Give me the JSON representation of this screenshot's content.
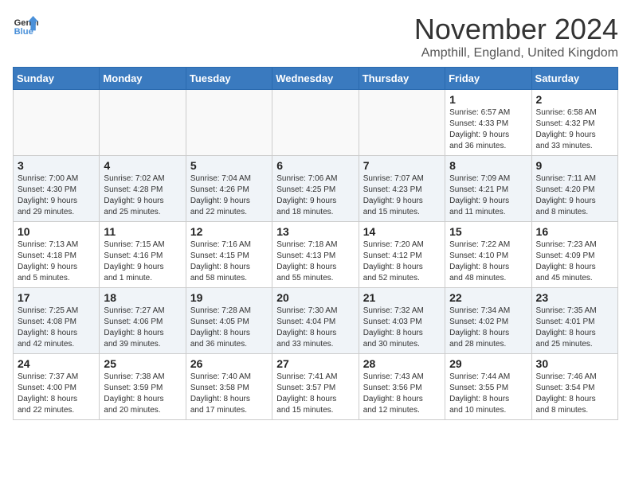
{
  "header": {
    "logo_general": "General",
    "logo_blue": "Blue",
    "month_title": "November 2024",
    "location": "Ampthill, England, United Kingdom"
  },
  "weekdays": [
    "Sunday",
    "Monday",
    "Tuesday",
    "Wednesday",
    "Thursday",
    "Friday",
    "Saturday"
  ],
  "weeks": [
    [
      {
        "num": "",
        "info": ""
      },
      {
        "num": "",
        "info": ""
      },
      {
        "num": "",
        "info": ""
      },
      {
        "num": "",
        "info": ""
      },
      {
        "num": "",
        "info": ""
      },
      {
        "num": "1",
        "info": "Sunrise: 6:57 AM\nSunset: 4:33 PM\nDaylight: 9 hours\nand 36 minutes."
      },
      {
        "num": "2",
        "info": "Sunrise: 6:58 AM\nSunset: 4:32 PM\nDaylight: 9 hours\nand 33 minutes."
      }
    ],
    [
      {
        "num": "3",
        "info": "Sunrise: 7:00 AM\nSunset: 4:30 PM\nDaylight: 9 hours\nand 29 minutes."
      },
      {
        "num": "4",
        "info": "Sunrise: 7:02 AM\nSunset: 4:28 PM\nDaylight: 9 hours\nand 25 minutes."
      },
      {
        "num": "5",
        "info": "Sunrise: 7:04 AM\nSunset: 4:26 PM\nDaylight: 9 hours\nand 22 minutes."
      },
      {
        "num": "6",
        "info": "Sunrise: 7:06 AM\nSunset: 4:25 PM\nDaylight: 9 hours\nand 18 minutes."
      },
      {
        "num": "7",
        "info": "Sunrise: 7:07 AM\nSunset: 4:23 PM\nDaylight: 9 hours\nand 15 minutes."
      },
      {
        "num": "8",
        "info": "Sunrise: 7:09 AM\nSunset: 4:21 PM\nDaylight: 9 hours\nand 11 minutes."
      },
      {
        "num": "9",
        "info": "Sunrise: 7:11 AM\nSunset: 4:20 PM\nDaylight: 9 hours\nand 8 minutes."
      }
    ],
    [
      {
        "num": "10",
        "info": "Sunrise: 7:13 AM\nSunset: 4:18 PM\nDaylight: 9 hours\nand 5 minutes."
      },
      {
        "num": "11",
        "info": "Sunrise: 7:15 AM\nSunset: 4:16 PM\nDaylight: 9 hours\nand 1 minute."
      },
      {
        "num": "12",
        "info": "Sunrise: 7:16 AM\nSunset: 4:15 PM\nDaylight: 8 hours\nand 58 minutes."
      },
      {
        "num": "13",
        "info": "Sunrise: 7:18 AM\nSunset: 4:13 PM\nDaylight: 8 hours\nand 55 minutes."
      },
      {
        "num": "14",
        "info": "Sunrise: 7:20 AM\nSunset: 4:12 PM\nDaylight: 8 hours\nand 52 minutes."
      },
      {
        "num": "15",
        "info": "Sunrise: 7:22 AM\nSunset: 4:10 PM\nDaylight: 8 hours\nand 48 minutes."
      },
      {
        "num": "16",
        "info": "Sunrise: 7:23 AM\nSunset: 4:09 PM\nDaylight: 8 hours\nand 45 minutes."
      }
    ],
    [
      {
        "num": "17",
        "info": "Sunrise: 7:25 AM\nSunset: 4:08 PM\nDaylight: 8 hours\nand 42 minutes."
      },
      {
        "num": "18",
        "info": "Sunrise: 7:27 AM\nSunset: 4:06 PM\nDaylight: 8 hours\nand 39 minutes."
      },
      {
        "num": "19",
        "info": "Sunrise: 7:28 AM\nSunset: 4:05 PM\nDaylight: 8 hours\nand 36 minutes."
      },
      {
        "num": "20",
        "info": "Sunrise: 7:30 AM\nSunset: 4:04 PM\nDaylight: 8 hours\nand 33 minutes."
      },
      {
        "num": "21",
        "info": "Sunrise: 7:32 AM\nSunset: 4:03 PM\nDaylight: 8 hours\nand 30 minutes."
      },
      {
        "num": "22",
        "info": "Sunrise: 7:34 AM\nSunset: 4:02 PM\nDaylight: 8 hours\nand 28 minutes."
      },
      {
        "num": "23",
        "info": "Sunrise: 7:35 AM\nSunset: 4:01 PM\nDaylight: 8 hours\nand 25 minutes."
      }
    ],
    [
      {
        "num": "24",
        "info": "Sunrise: 7:37 AM\nSunset: 4:00 PM\nDaylight: 8 hours\nand 22 minutes."
      },
      {
        "num": "25",
        "info": "Sunrise: 7:38 AM\nSunset: 3:59 PM\nDaylight: 8 hours\nand 20 minutes."
      },
      {
        "num": "26",
        "info": "Sunrise: 7:40 AM\nSunset: 3:58 PM\nDaylight: 8 hours\nand 17 minutes."
      },
      {
        "num": "27",
        "info": "Sunrise: 7:41 AM\nSunset: 3:57 PM\nDaylight: 8 hours\nand 15 minutes."
      },
      {
        "num": "28",
        "info": "Sunrise: 7:43 AM\nSunset: 3:56 PM\nDaylight: 8 hours\nand 12 minutes."
      },
      {
        "num": "29",
        "info": "Sunrise: 7:44 AM\nSunset: 3:55 PM\nDaylight: 8 hours\nand 10 minutes."
      },
      {
        "num": "30",
        "info": "Sunrise: 7:46 AM\nSunset: 3:54 PM\nDaylight: 8 hours\nand 8 minutes."
      }
    ]
  ]
}
